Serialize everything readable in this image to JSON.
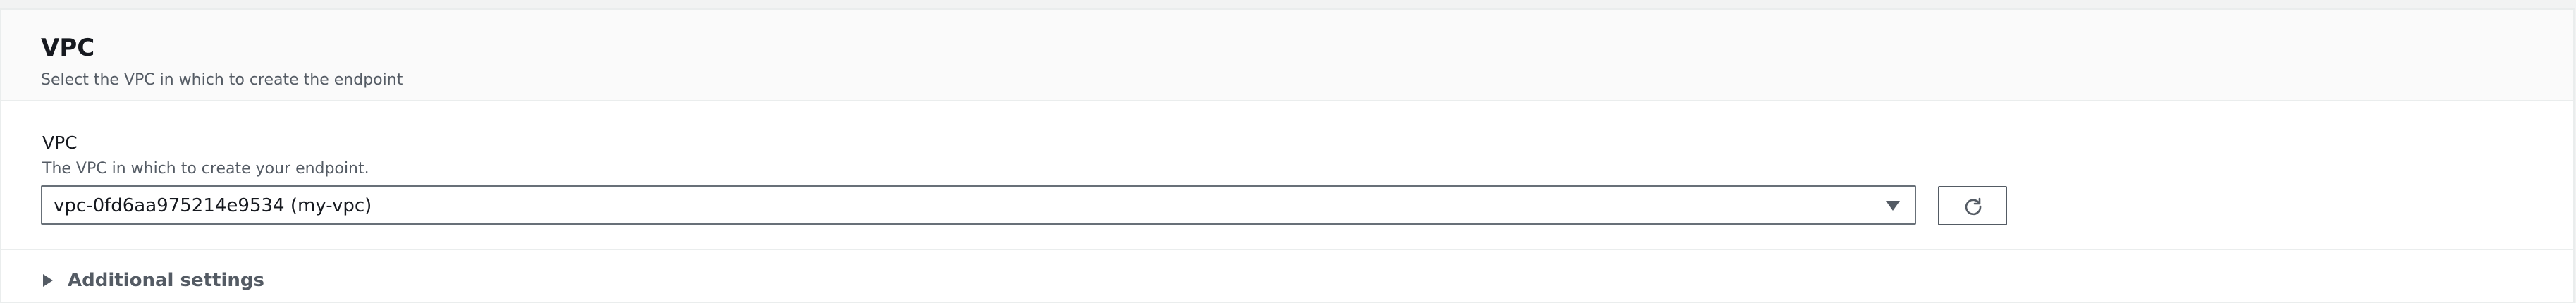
{
  "section": {
    "title": "VPC",
    "description": "Select the VPC in which to create the endpoint"
  },
  "vpc_field": {
    "label": "VPC",
    "description": "The VPC in which to create your endpoint.",
    "selected_value": "vpc-0fd6aa975214e9534 (my-vpc)",
    "caret_icon": "caret-down-icon",
    "refresh_icon": "refresh-icon"
  },
  "additional_settings": {
    "label": "Additional settings",
    "expanded": false,
    "caret_icon": "caret-right-icon"
  }
}
